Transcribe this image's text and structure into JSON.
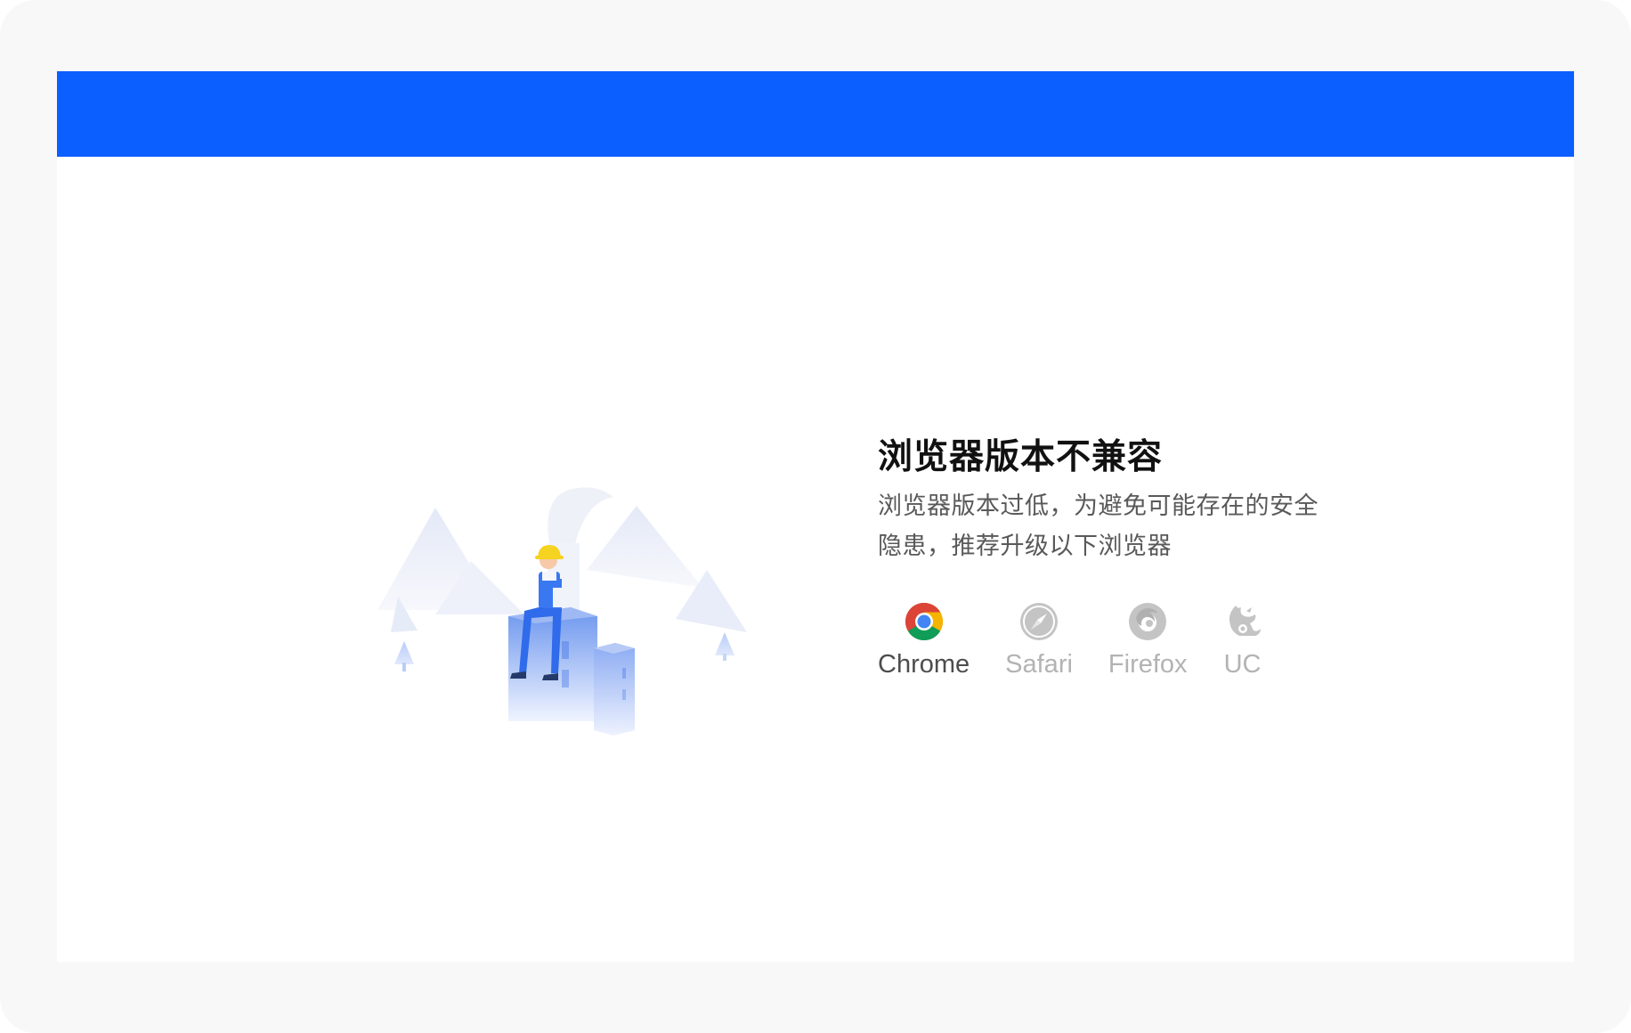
{
  "page": {
    "title": "浏览器版本不兼容",
    "description": "浏览器版本过低，为避免可能存在的安全隐患，推荐升级以下浏览器"
  },
  "colors": {
    "header_bar": "#0b5eff",
    "frame": "#f8f8f8",
    "title": "#111111",
    "description": "#595959",
    "browser_active": "#4d4d4d",
    "browser_inactive": "#b3b3b3"
  },
  "browsers": [
    {
      "label": "Chrome",
      "icon": "chrome-icon",
      "active": true
    },
    {
      "label": "Safari",
      "icon": "safari-icon",
      "active": false
    },
    {
      "label": "Firefox",
      "icon": "firefox-icon",
      "active": false
    },
    {
      "label": "UC",
      "icon": "uc-icon",
      "active": false
    }
  ],
  "illustration": {
    "icon": "worker-on-building-illustration"
  }
}
